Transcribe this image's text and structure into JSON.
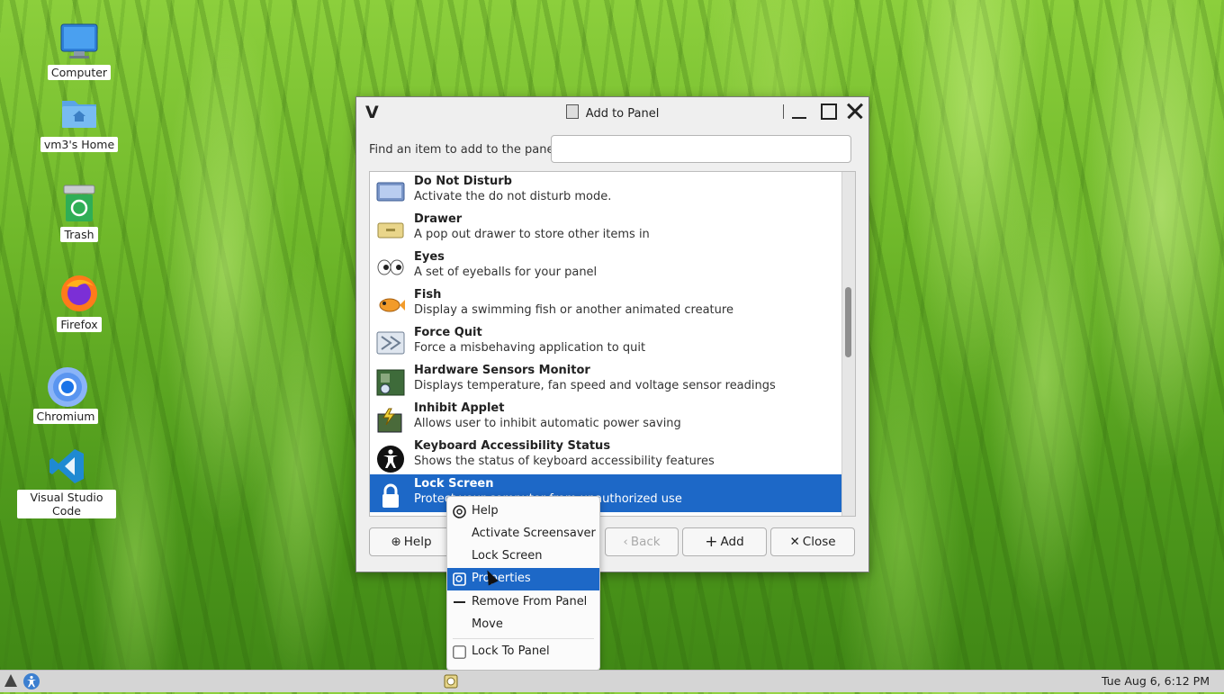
{
  "desktop": {
    "icons": [
      {
        "label": "Computer",
        "icon": "monitor-icon"
      },
      {
        "label": "vm3's Home",
        "icon": "home-folder-icon"
      },
      {
        "label": "Trash",
        "icon": "trash-icon"
      },
      {
        "label": "Firefox",
        "icon": "firefox-icon"
      },
      {
        "label": "Chromium",
        "icon": "chromium-icon"
      },
      {
        "label": "Visual Studio Code",
        "icon": "vscode-icon"
      }
    ]
  },
  "window": {
    "title": "Add to Panel",
    "find_label": "Find an item to add to the panel:",
    "find_value": "",
    "items": [
      {
        "name": "Do Not Disturb",
        "desc": "Activate the do not disturb mode.",
        "icon": "do-not-disturb-icon"
      },
      {
        "name": "Drawer",
        "desc": "A pop out drawer to store other items in",
        "icon": "drawer-icon"
      },
      {
        "name": "Eyes",
        "desc": "A set of eyeballs for your panel",
        "icon": "eyes-icon"
      },
      {
        "name": "Fish",
        "desc": "Display a swimming fish or another animated creature",
        "icon": "fish-icon"
      },
      {
        "name": "Force Quit",
        "desc": "Force a misbehaving application to quit",
        "icon": "force-quit-icon"
      },
      {
        "name": "Hardware Sensors Monitor",
        "desc": "Displays temperature, fan speed and voltage sensor readings",
        "icon": "sensors-icon"
      },
      {
        "name": "Inhibit Applet",
        "desc": "Allows user to inhibit automatic power saving",
        "icon": "inhibit-icon"
      },
      {
        "name": "Keyboard Accessibility Status",
        "desc": "Shows the status of keyboard accessibility features",
        "icon": "accessibility-icon"
      },
      {
        "name": "Lock Screen",
        "desc": "Protect your computer from unauthorized use",
        "icon": "lock-icon"
      }
    ],
    "buttons": {
      "help": "Help",
      "back": "Back",
      "add": "Add",
      "close": "Close"
    }
  },
  "context_menu": {
    "items": [
      {
        "label": "Help",
        "icon": "help-icon"
      },
      {
        "label": "Activate Screensaver",
        "icon": ""
      },
      {
        "label": "Lock Screen",
        "icon": ""
      },
      {
        "label": "Properties",
        "icon": "properties-icon"
      },
      {
        "label": "Remove From Panel",
        "icon": "remove-icon"
      },
      {
        "label": "Move",
        "icon": ""
      },
      {
        "label": "Lock To Panel",
        "icon": "checkbox-icon",
        "checked": false
      }
    ],
    "highlighted": "Properties"
  },
  "panel": {
    "clock": "Tue Aug  6,  6:12 PM"
  },
  "colors": {
    "selection": "#1d68c7",
    "panel": "#d5d5d5"
  }
}
